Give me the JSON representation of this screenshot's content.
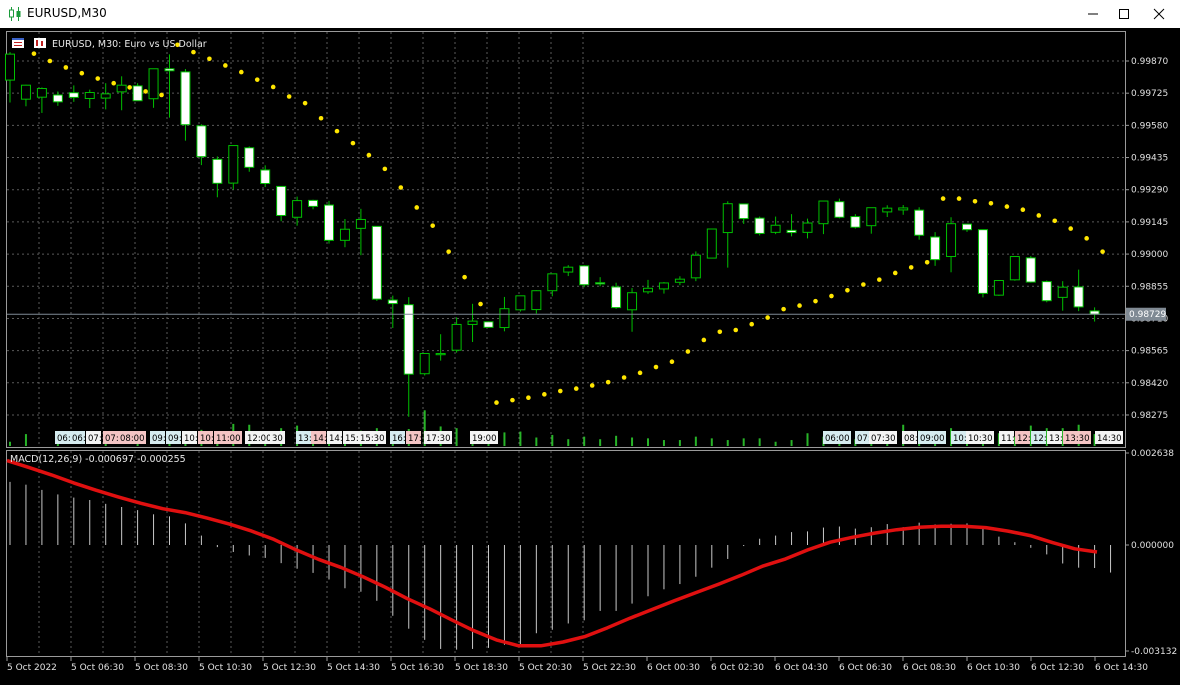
{
  "window": {
    "title": "EURUSD,M30"
  },
  "header": {
    "label": "EURUSD, M30:  Euro vs US Dollar"
  },
  "macd": {
    "label": "MACD(12,26,9) -0.000697 -0.000255"
  },
  "colors": {
    "background": "#000000",
    "grid": "#5a5a5a",
    "bull_body": "#000000",
    "bear_body": "#ffffff",
    "candle_wick": "#00c000",
    "sar": "#ffe600",
    "macd_signal": "#e01010",
    "macd_hist": "#c8c8c8",
    "volume": "#28b428",
    "price_line": "#7f8a96"
  },
  "price_axis": {
    "ticks": [
      "0.99870",
      "0.99725",
      "0.99580",
      "0.99435",
      "0.99290",
      "0.99145",
      "0.99000",
      "0.98855",
      "0.98710",
      "0.98565",
      "0.98420",
      "0.98275"
    ],
    "current": "0.98729"
  },
  "macd_axis": {
    "ticks": [
      "0.002638",
      "0.000000",
      "-0.003132"
    ]
  },
  "time_axis": {
    "labels": [
      "5 Oct 2022",
      "5 Oct 06:30",
      "5 Oct 08:30",
      "5 Oct 10:30",
      "5 Oct 12:30",
      "5 Oct 14:30",
      "5 Oct 16:30",
      "5 Oct 18:30",
      "5 Oct 20:30",
      "5 Oct 22:30",
      "6 Oct 00:30",
      "6 Oct 02:30",
      "6 Oct 04:30",
      "6 Oct 06:30",
      "6 Oct 08:30",
      "6 Oct 10:30",
      "6 Oct 12:30",
      "6 Oct 14:30"
    ]
  },
  "session_tags": [
    {
      "text": "06:",
      "color": "#d6ecf0"
    },
    {
      "text": "06:",
      "color": "#d6ecf0"
    },
    {
      "text": "07:",
      "color": "#f4f4f4"
    },
    {
      "text": "07:",
      "color": "#f4c4c4"
    },
    {
      "text": "08:00",
      "color": "#f4c4c4"
    },
    {
      "text": "09:",
      "color": "#d6ecf0"
    },
    {
      "text": "09:",
      "color": "#d6ecf0"
    },
    {
      "text": "10:",
      "color": "#f4f4f4"
    },
    {
      "text": "10:",
      "color": "#f4c4c4"
    },
    {
      "text": "11:00",
      "color": "#f4c4c4"
    },
    {
      "text": "12:00",
      "color": "#f4f4f4"
    },
    {
      "text": "30",
      "color": "#f4f4f4"
    },
    {
      "text": "13:",
      "color": "#d6ecf0"
    },
    {
      "text": "14:",
      "color": "#f4c4c4"
    },
    {
      "text": "14:",
      "color": "#f4f4f4"
    },
    {
      "text": "15:",
      "color": "#f4f4f4"
    },
    {
      "text": "15:30",
      "color": "#f4f4f4"
    },
    {
      "text": "16:",
      "color": "#d6ecf0"
    },
    {
      "text": "17:",
      "color": "#f4c4c4"
    },
    {
      "text": "17:30",
      "color": "#f4f4f4"
    },
    {
      "text": "19:00",
      "color": "#f4f4f4"
    },
    {
      "text": "06:00",
      "color": "#d6ecf0"
    },
    {
      "text": "07:",
      "color": "#d6ecf0"
    },
    {
      "text": "07:30",
      "color": "#f4f4f4"
    },
    {
      "text": "08:",
      "color": "#f4f4f4"
    },
    {
      "text": "09:00",
      "color": "#d6ecf0"
    },
    {
      "text": "10:",
      "color": "#d6ecf0"
    },
    {
      "text": "10:30",
      "color": "#f4f4f4"
    },
    {
      "text": "11:",
      "color": "#f4f4f4"
    },
    {
      "text": "12:",
      "color": "#f4c4c4"
    },
    {
      "text": "12:",
      "color": "#d6ecf0"
    },
    {
      "text": "13:",
      "color": "#f4f4f4"
    },
    {
      "text": "13:30",
      "color": "#f4c4c4"
    },
    {
      "text": "14:30",
      "color": "#f4f4f4"
    }
  ],
  "chart_data": {
    "type": "candlestick",
    "symbol": "EURUSD",
    "timeframe": "M30",
    "ylim": [
      0.98238,
      1.0
    ],
    "candles": [
      {
        "o": 0.99784,
        "h": 0.9991,
        "l": 0.99683,
        "c": 0.99901
      },
      {
        "o": 0.99698,
        "h": 0.99763,
        "l": 0.99666,
        "c": 0.99761
      },
      {
        "o": 0.99707,
        "h": 0.99751,
        "l": 0.99636,
        "c": 0.99746
      },
      {
        "o": 0.99717,
        "h": 0.99733,
        "l": 0.99668,
        "c": 0.99686
      },
      {
        "o": 0.99727,
        "h": 0.9976,
        "l": 0.99686,
        "c": 0.99706
      },
      {
        "o": 0.99701,
        "h": 0.99741,
        "l": 0.99658,
        "c": 0.99728
      },
      {
        "o": 0.99703,
        "h": 0.9977,
        "l": 0.99652,
        "c": 0.99722
      },
      {
        "o": 0.99731,
        "h": 0.99801,
        "l": 0.99648,
        "c": 0.99761
      },
      {
        "o": 0.99758,
        "h": 0.9977,
        "l": 0.99691,
        "c": 0.99691
      },
      {
        "o": 0.997,
        "h": 0.99835,
        "l": 0.99659,
        "c": 0.99835
      },
      {
        "o": 0.99835,
        "h": 0.999,
        "l": 0.99615,
        "c": 0.99826
      },
      {
        "o": 0.99821,
        "h": 0.99834,
        "l": 0.99511,
        "c": 0.99583
      },
      {
        "o": 0.99578,
        "h": 0.99585,
        "l": 0.99401,
        "c": 0.99439
      },
      {
        "o": 0.99427,
        "h": 0.9944,
        "l": 0.99256,
        "c": 0.99319
      },
      {
        "o": 0.9932,
        "h": 0.99489,
        "l": 0.99291,
        "c": 0.99489
      },
      {
        "o": 0.99479,
        "h": 0.99485,
        "l": 0.99371,
        "c": 0.99391
      },
      {
        "o": 0.99379,
        "h": 0.994,
        "l": 0.99302,
        "c": 0.99318
      },
      {
        "o": 0.99305,
        "h": 0.99306,
        "l": 0.99148,
        "c": 0.99174
      },
      {
        "o": 0.99166,
        "h": 0.99259,
        "l": 0.99128,
        "c": 0.99241
      },
      {
        "o": 0.99242,
        "h": 0.99245,
        "l": 0.99202,
        "c": 0.99215
      },
      {
        "o": 0.99221,
        "h": 0.9924,
        "l": 0.99047,
        "c": 0.99062
      },
      {
        "o": 0.99062,
        "h": 0.99158,
        "l": 0.99031,
        "c": 0.99112
      },
      {
        "o": 0.99116,
        "h": 0.99204,
        "l": 0.98995,
        "c": 0.99156
      },
      {
        "o": 0.99125,
        "h": 0.99125,
        "l": 0.98789,
        "c": 0.98797
      },
      {
        "o": 0.98793,
        "h": 0.98813,
        "l": 0.98667,
        "c": 0.98777
      },
      {
        "o": 0.98772,
        "h": 0.98806,
        "l": 0.98267,
        "c": 0.98459
      },
      {
        "o": 0.98461,
        "h": 0.98542,
        "l": 0.98453,
        "c": 0.98552
      },
      {
        "o": 0.98547,
        "h": 0.98639,
        "l": 0.9852,
        "c": 0.98552
      },
      {
        "o": 0.98567,
        "h": 0.98715,
        "l": 0.98556,
        "c": 0.98683
      },
      {
        "o": 0.98683,
        "h": 0.98776,
        "l": 0.98604,
        "c": 0.98698
      },
      {
        "o": 0.98695,
        "h": 0.98697,
        "l": 0.98668,
        "c": 0.9867
      },
      {
        "o": 0.98669,
        "h": 0.98807,
        "l": 0.98652,
        "c": 0.98754
      },
      {
        "o": 0.98749,
        "h": 0.98812,
        "l": 0.98741,
        "c": 0.98812
      },
      {
        "o": 0.9875,
        "h": 0.98837,
        "l": 0.98732,
        "c": 0.98835
      },
      {
        "o": 0.98835,
        "h": 0.98911,
        "l": 0.9881,
        "c": 0.98911
      },
      {
        "o": 0.98919,
        "h": 0.9895,
        "l": 0.98901,
        "c": 0.98941
      },
      {
        "o": 0.98947,
        "h": 0.9895,
        "l": 0.98851,
        "c": 0.98862
      },
      {
        "o": 0.98871,
        "h": 0.98896,
        "l": 0.98855,
        "c": 0.98869
      },
      {
        "o": 0.98852,
        "h": 0.98871,
        "l": 0.98753,
        "c": 0.98759
      },
      {
        "o": 0.98749,
        "h": 0.98847,
        "l": 0.9865,
        "c": 0.98826
      },
      {
        "o": 0.9883,
        "h": 0.98884,
        "l": 0.98821,
        "c": 0.98846
      },
      {
        "o": 0.98843,
        "h": 0.98874,
        "l": 0.98822,
        "c": 0.9887
      },
      {
        "o": 0.98873,
        "h": 0.989,
        "l": 0.9886,
        "c": 0.98887
      },
      {
        "o": 0.98893,
        "h": 0.99012,
        "l": 0.98878,
        "c": 0.98995
      },
      {
        "o": 0.98982,
        "h": 0.99113,
        "l": 0.98982,
        "c": 0.99113
      },
      {
        "o": 0.99097,
        "h": 0.99238,
        "l": 0.98939,
        "c": 0.99227
      },
      {
        "o": 0.99226,
        "h": 0.99226,
        "l": 0.99136,
        "c": 0.9916
      },
      {
        "o": 0.99162,
        "h": 0.99169,
        "l": 0.99084,
        "c": 0.99093
      },
      {
        "o": 0.99098,
        "h": 0.99169,
        "l": 0.9909,
        "c": 0.9913
      },
      {
        "o": 0.99107,
        "h": 0.9918,
        "l": 0.9908,
        "c": 0.99097
      },
      {
        "o": 0.99098,
        "h": 0.9916,
        "l": 0.99071,
        "c": 0.9914
      },
      {
        "o": 0.99137,
        "h": 0.99239,
        "l": 0.9909,
        "c": 0.99239
      },
      {
        "o": 0.99236,
        "h": 0.9925,
        "l": 0.99161,
        "c": 0.99166
      },
      {
        "o": 0.99169,
        "h": 0.9918,
        "l": 0.99115,
        "c": 0.99121
      },
      {
        "o": 0.99128,
        "h": 0.99209,
        "l": 0.99092,
        "c": 0.99209
      },
      {
        "o": 0.9919,
        "h": 0.9922,
        "l": 0.99167,
        "c": 0.99207
      },
      {
        "o": 0.99199,
        "h": 0.99221,
        "l": 0.99177,
        "c": 0.99208
      },
      {
        "o": 0.99198,
        "h": 0.99211,
        "l": 0.99065,
        "c": 0.99085
      },
      {
        "o": 0.99077,
        "h": 0.99099,
        "l": 0.98947,
        "c": 0.98975
      },
      {
        "o": 0.98989,
        "h": 0.99166,
        "l": 0.98918,
        "c": 0.99137
      },
      {
        "o": 0.99135,
        "h": 0.99136,
        "l": 0.991,
        "c": 0.9911
      },
      {
        "o": 0.9911,
        "h": 0.9911,
        "l": 0.98805,
        "c": 0.98823
      },
      {
        "o": 0.98815,
        "h": 0.98881,
        "l": 0.98812,
        "c": 0.98881
      },
      {
        "o": 0.98884,
        "h": 0.9899,
        "l": 0.9888,
        "c": 0.98989
      },
      {
        "o": 0.98983,
        "h": 0.98991,
        "l": 0.98871,
        "c": 0.98874
      },
      {
        "o": 0.98876,
        "h": 0.98881,
        "l": 0.98783,
        "c": 0.9879
      },
      {
        "o": 0.98805,
        "h": 0.98878,
        "l": 0.98745,
        "c": 0.98851
      },
      {
        "o": 0.98852,
        "h": 0.9893,
        "l": 0.98743,
        "c": 0.98762
      },
      {
        "o": 0.98744,
        "h": 0.9876,
        "l": 0.98696,
        "c": 0.98729
      }
    ],
    "sar": [
      0.99943,
      0.99903,
      0.9987,
      0.99841,
      0.99815,
      0.99791,
      0.9977,
      0.99751,
      0.99733,
      0.99717,
      0.99943,
      0.9991,
      0.9988,
      0.9985,
      0.9982,
      0.99786,
      0.99753,
      0.9971,
      0.9968,
      0.99612,
      0.99554,
      0.995,
      0.99446,
      0.99384,
      0.993,
      0.9921,
      0.99128,
      0.99011,
      0.98896,
      0.98775,
      0.98331,
      0.98342,
      0.98353,
      0.98368,
      0.98383,
      0.98394,
      0.98408,
      0.98423,
      0.98444,
      0.98465,
      0.98491,
      0.98515,
      0.98561,
      0.98613,
      0.9865,
      0.98658,
      0.98684,
      0.98714,
      0.98752,
      0.98768,
      0.98788,
      0.98811,
      0.98837,
      0.98863,
      0.98885,
      0.98915,
      0.9894,
      0.98963,
      0.9925,
      0.9925,
      0.99238,
      0.99229,
      0.99214,
      0.992,
      0.99174,
      0.9915,
      0.99115,
      0.99071,
      0.99011
    ],
    "volume": [
      5,
      14,
      0,
      17,
      0,
      0,
      9,
      0,
      14,
      0,
      12,
      14,
      19,
      16,
      26,
      25,
      17,
      21,
      24,
      12,
      12,
      16,
      18,
      21,
      11,
      20,
      42,
      23,
      21,
      16,
      17,
      16,
      17,
      10,
      13,
      8,
      11,
      8,
      12,
      10,
      9,
      7,
      7,
      11,
      9,
      7,
      9,
      9,
      5,
      7,
      15,
      11,
      12,
      8,
      12,
      15,
      25,
      18,
      17,
      21,
      16,
      16,
      15,
      11,
      24,
      21,
      21,
      25,
      14
    ],
    "macd_hist": [
      0.00181,
      0.00173,
      0.00158,
      0.00145,
      0.00136,
      0.00129,
      0.00118,
      0.00109,
      0.001,
      0.00088,
      0.00082,
      0.00062,
      0.00027,
      -6e-05,
      -0.0002,
      -0.0003,
      -0.00037,
      -0.00052,
      -0.00068,
      -0.0008,
      -0.00099,
      -0.00124,
      -0.00134,
      -0.0016,
      -0.00203,
      -0.0024,
      -0.00272,
      -0.00298,
      -0.003,
      -0.00298,
      -0.00295,
      -0.00286,
      -0.00284,
      -0.00253,
      -0.00243,
      -0.00225,
      -0.00216,
      -0.00189,
      -0.00189,
      -0.00168,
      -0.00147,
      -0.00127,
      -0.00112,
      -0.00091,
      -0.00065,
      -0.0004,
      -3e-05,
      0.00018,
      0.00027,
      0.00037,
      0.00039,
      0.0005,
      0.00053,
      0.00047,
      0.00051,
      0.0006,
      0.00051,
      0.00064,
      0.00059,
      0.00061,
      0.00062,
      0.00047,
      0.00024,
      8e-05,
      -8e-05,
      -0.00027,
      -0.00053,
      -0.00065,
      -0.00066,
      -0.00079
    ],
    "macd_signal": [
      0.00242,
      0.00222,
      0.00201,
      0.00178,
      0.00157,
      0.00138,
      0.0012,
      0.00104,
      0.00093,
      0.00077,
      0.0006,
      0.0004,
      0.00016,
      -0.00014,
      -0.00041,
      -0.00064,
      -0.00091,
      -0.00121,
      -0.00154,
      -0.00183,
      -0.00215,
      -0.00246,
      -0.00272,
      -0.00289,
      -0.00289,
      -0.00278,
      -0.00262,
      -0.00237,
      -0.0021,
      -0.00185,
      -0.0016,
      -0.00136,
      -0.00112,
      -0.00087,
      -0.0006,
      -0.0004,
      -0.00014,
      8e-05,
      0.00022,
      0.00034,
      0.00044,
      0.00051,
      0.00054,
      0.00054,
      0.0005,
      0.0004,
      0.00027,
      7e-05,
      -0.00011,
      -0.0002
    ]
  }
}
